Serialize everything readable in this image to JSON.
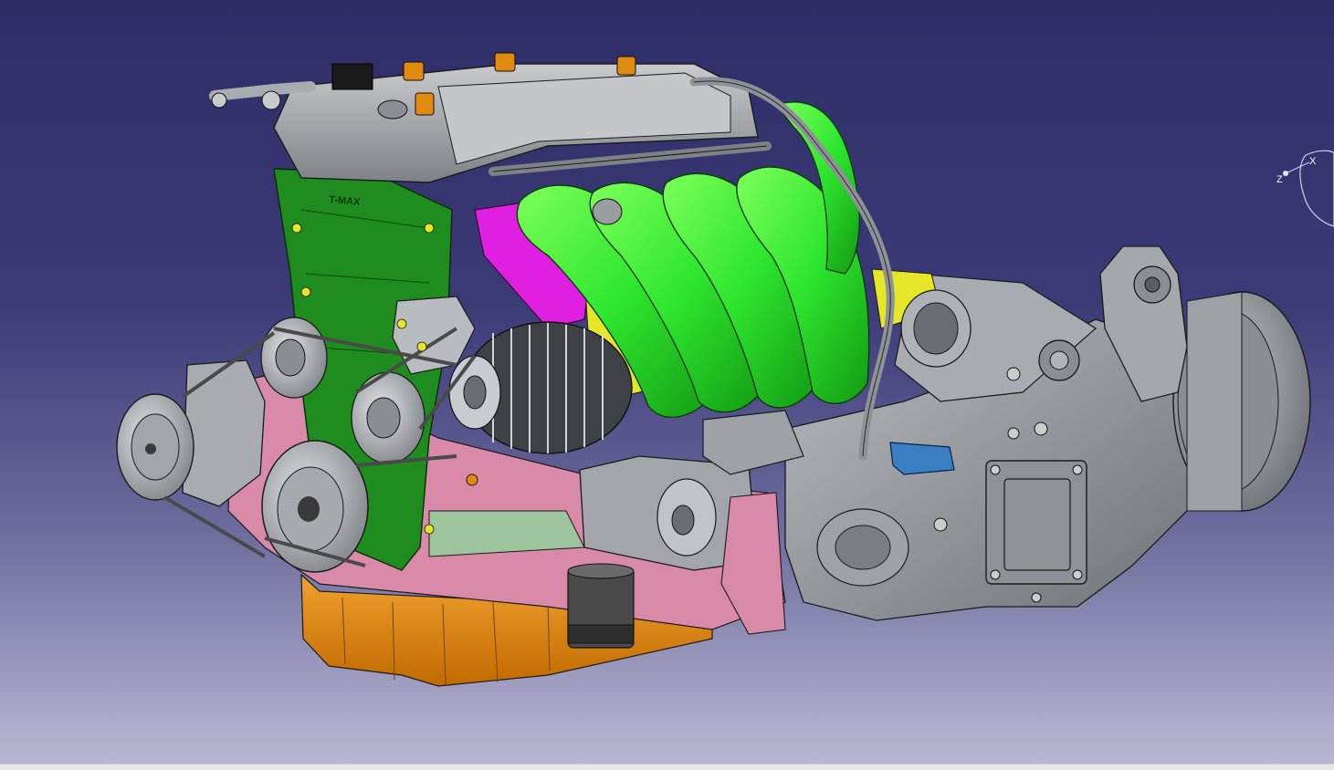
{
  "window": {
    "title": ""
  },
  "viewport": {
    "background_top": "#2e2d66",
    "background_bottom": "#b9b8d2"
  },
  "model": {
    "description_icon": "engine-assembly-3d-model",
    "engraved_text": "T-MAX",
    "colors": {
      "intake_manifold": "#2ee62e",
      "timing_cover": "#1e8c1e",
      "valve_cover": "#a9a9a9",
      "oil_pan": "#e08a10",
      "engine_block_pink": "#d98aa8",
      "manifold_flange_magenta": "#e020e0",
      "transmission": "#9a9ea2",
      "sensor_blue": "#3a7fc4",
      "bracket_yellow": "#e6e628"
    }
  },
  "compass": {
    "axis_x": "X",
    "axis_z": "Z"
  }
}
